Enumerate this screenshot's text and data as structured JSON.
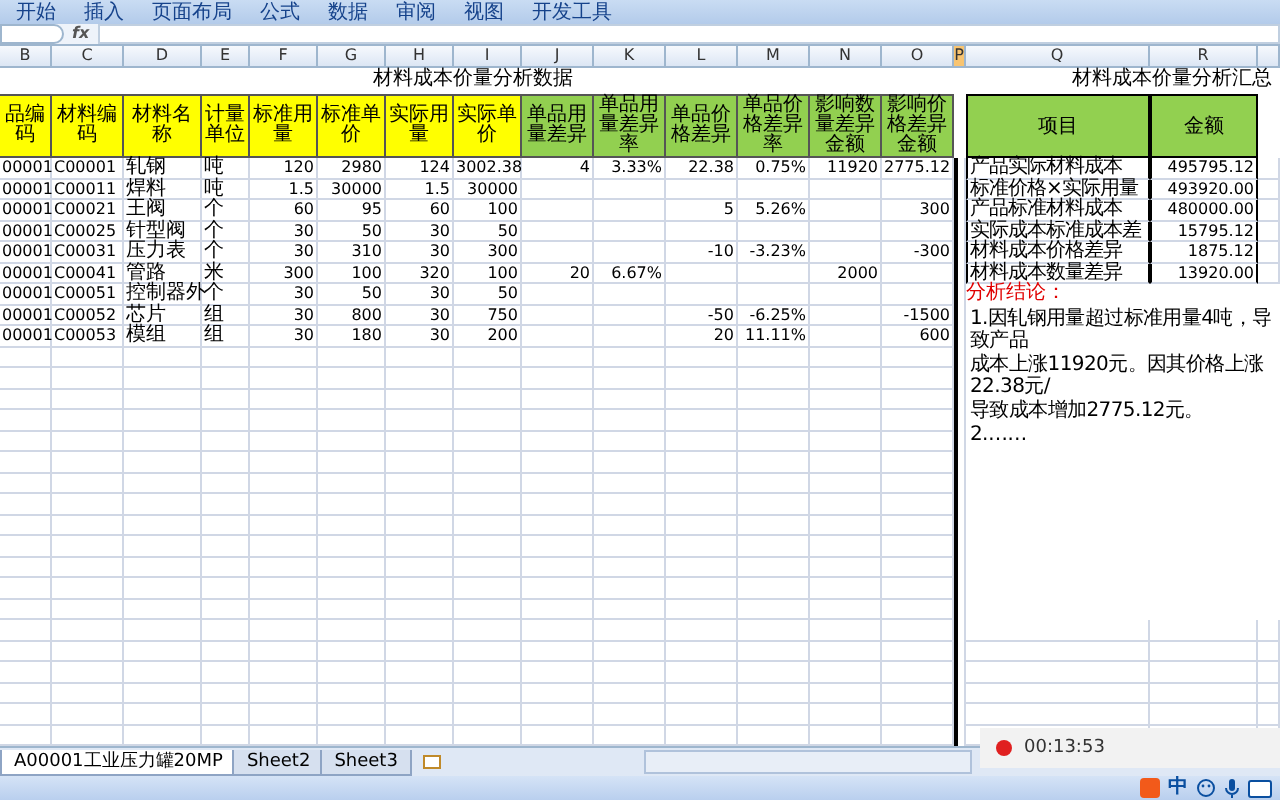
{
  "ribbon_tabs": [
    "开始",
    "插入",
    "页面布局",
    "公式",
    "数据",
    "审阅",
    "视图",
    "开发工具"
  ],
  "formula_bar": {
    "fx": "fx"
  },
  "columns": [
    {
      "label": "B",
      "selected": false
    },
    {
      "label": "C",
      "selected": false
    },
    {
      "label": "D",
      "selected": false
    },
    {
      "label": "E",
      "selected": false
    },
    {
      "label": "F",
      "selected": false
    },
    {
      "label": "G",
      "selected": false
    },
    {
      "label": "H",
      "selected": false
    },
    {
      "label": "I",
      "selected": false
    },
    {
      "label": "J",
      "selected": false
    },
    {
      "label": "K",
      "selected": false
    },
    {
      "label": "L",
      "selected": false
    },
    {
      "label": "M",
      "selected": false
    },
    {
      "label": "N",
      "selected": false
    },
    {
      "label": "O",
      "selected": false
    },
    {
      "label": "P",
      "selected": true
    },
    {
      "label": "Q",
      "selected": false
    },
    {
      "label": "R",
      "selected": false
    }
  ],
  "data_table": {
    "title": "材料成本价量分析数据",
    "headers": [
      {
        "text": "品编码",
        "color": "#ffff00"
      },
      {
        "text": "材料编码",
        "color": "#ffff00"
      },
      {
        "text": "材料名称",
        "color": "#ffff00"
      },
      {
        "text": "计量单位",
        "color": "#ffff00"
      },
      {
        "text": "标准用量",
        "color": "#ffff00"
      },
      {
        "text": "标准单价",
        "color": "#ffff00"
      },
      {
        "text": "实际用量",
        "color": "#ffff00"
      },
      {
        "text": "实际单价",
        "color": "#ffff00"
      },
      {
        "text": "单品用量差异",
        "color": "#92d050"
      },
      {
        "text": "单品用量差异率",
        "color": "#92d050"
      },
      {
        "text": "单品价格差异",
        "color": "#92d050"
      },
      {
        "text": "单品价格差异率",
        "color": "#92d050"
      },
      {
        "text": "影响数量差异金额",
        "color": "#92d050"
      },
      {
        "text": "影响价格差异金额",
        "color": "#92d050"
      }
    ],
    "rows": [
      [
        "00001",
        "C00001",
        "轧钢",
        "吨",
        "120",
        "2980",
        "124",
        "3002.38",
        "4",
        "3.33%",
        "22.38",
        "0.75%",
        "11920",
        "2775.12"
      ],
      [
        "00001",
        "C00011",
        "焊料",
        "吨",
        "1.5",
        "30000",
        "1.5",
        "30000",
        null,
        null,
        null,
        null,
        null,
        null
      ],
      [
        "00001",
        "C00021",
        "王阀",
        "个",
        "60",
        "95",
        "60",
        "100",
        null,
        null,
        "5",
        "5.26%",
        null,
        "300"
      ],
      [
        "00001",
        "C00025",
        "针型阀",
        "个",
        "30",
        "50",
        "30",
        "50",
        null,
        null,
        null,
        null,
        null,
        null
      ],
      [
        "00001",
        "C00031",
        "压力表",
        "个",
        "30",
        "310",
        "30",
        "300",
        null,
        null,
        "-10",
        "-3.23%",
        null,
        "-300"
      ],
      [
        "00001",
        "C00041",
        "管路",
        "米",
        "300",
        "100",
        "320",
        "100",
        "20",
        "6.67%",
        null,
        null,
        "2000",
        null
      ],
      [
        "00001",
        "C00051",
        "控制器外",
        "个",
        "30",
        "50",
        "30",
        "50",
        null,
        null,
        null,
        null,
        null,
        null
      ],
      [
        "00001",
        "C00052",
        "芯片",
        "组",
        "30",
        "800",
        "30",
        "750",
        null,
        null,
        "-50",
        "-6.25%",
        null,
        "-1500"
      ],
      [
        "00001",
        "C00053",
        "模组",
        "组",
        "30",
        "180",
        "30",
        "200",
        null,
        null,
        "20",
        "11.11%",
        null,
        "600"
      ]
    ]
  },
  "summary_table": {
    "title": "材料成本价量分析汇总",
    "headers": [
      "项目",
      "金额"
    ],
    "rows": [
      [
        "产品实际材料成本",
        "495795.12"
      ],
      [
        "标准价格×实际用量",
        "493920.00"
      ],
      [
        "产品标准材料成本",
        "480000.00"
      ],
      [
        "实际成本标准成本差",
        "15795.12"
      ],
      [
        "材料成本价格差异",
        "1875.12"
      ],
      [
        "材料成本数量差异",
        "13920.00"
      ]
    ]
  },
  "conclusion": {
    "heading": "分析结论：",
    "lines": [
      "1.因轧钢用量超过标准用量4吨，导致产品",
      "成本上涨11920元。因其价格上涨22.38元/",
      "导致成本增加2775.12元。",
      "2.……"
    ]
  },
  "sheet_tabs": [
    {
      "label": "A00001工业压力罐20MP",
      "selected": true
    },
    {
      "label": "Sheet2",
      "selected": false
    },
    {
      "label": "Sheet3",
      "selected": false
    }
  ],
  "recorder": {
    "time": "00:13:53"
  },
  "taskbar": {
    "ime": "中"
  }
}
